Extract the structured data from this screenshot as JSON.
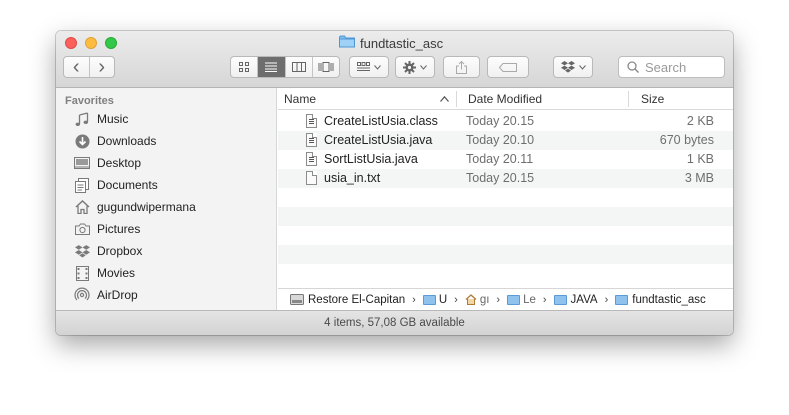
{
  "window": {
    "title": "fundtastic_asc"
  },
  "toolbar": {
    "back_glyph": "‹",
    "forward_glyph": "›",
    "search_placeholder": "Search"
  },
  "sidebar": {
    "heading": "Favorites",
    "items": [
      {
        "label": "Music",
        "icon": "music-note-icon"
      },
      {
        "label": "Downloads",
        "icon": "download-icon"
      },
      {
        "label": "Desktop",
        "icon": "desktop-icon"
      },
      {
        "label": "Documents",
        "icon": "documents-icon"
      },
      {
        "label": "gugundwipermana",
        "icon": "home-icon"
      },
      {
        "label": "Pictures",
        "icon": "camera-icon"
      },
      {
        "label": "Dropbox",
        "icon": "dropbox-icon"
      },
      {
        "label": "Movies",
        "icon": "film-icon"
      },
      {
        "label": "AirDrop",
        "icon": "airdrop-icon"
      }
    ]
  },
  "columns": {
    "name": "Name",
    "date": "Date Modified",
    "size": "Size"
  },
  "files": [
    {
      "name": "CreateListUsia.class",
      "date": "Today 20.15",
      "size": "2 KB"
    },
    {
      "name": "CreateListUsia.java",
      "date": "Today 20.10",
      "size": "670 bytes"
    },
    {
      "name": "SortListUsia.java",
      "date": "Today 20.11",
      "size": "1 KB"
    },
    {
      "name": "usia_in.txt",
      "date": "Today 20.15",
      "size": "3 MB"
    }
  ],
  "pathbar": {
    "items": [
      "Restore El-Capitan",
      "U",
      "gı",
      "Le",
      "JAVA",
      "fundtastic_asc"
    ]
  },
  "status": {
    "text": "4 items, 57,08 GB available"
  },
  "colors": {
    "folder": "#5aa9e6",
    "close": "#fc605c",
    "minimize": "#fdbc40",
    "maximize": "#34c84a"
  }
}
